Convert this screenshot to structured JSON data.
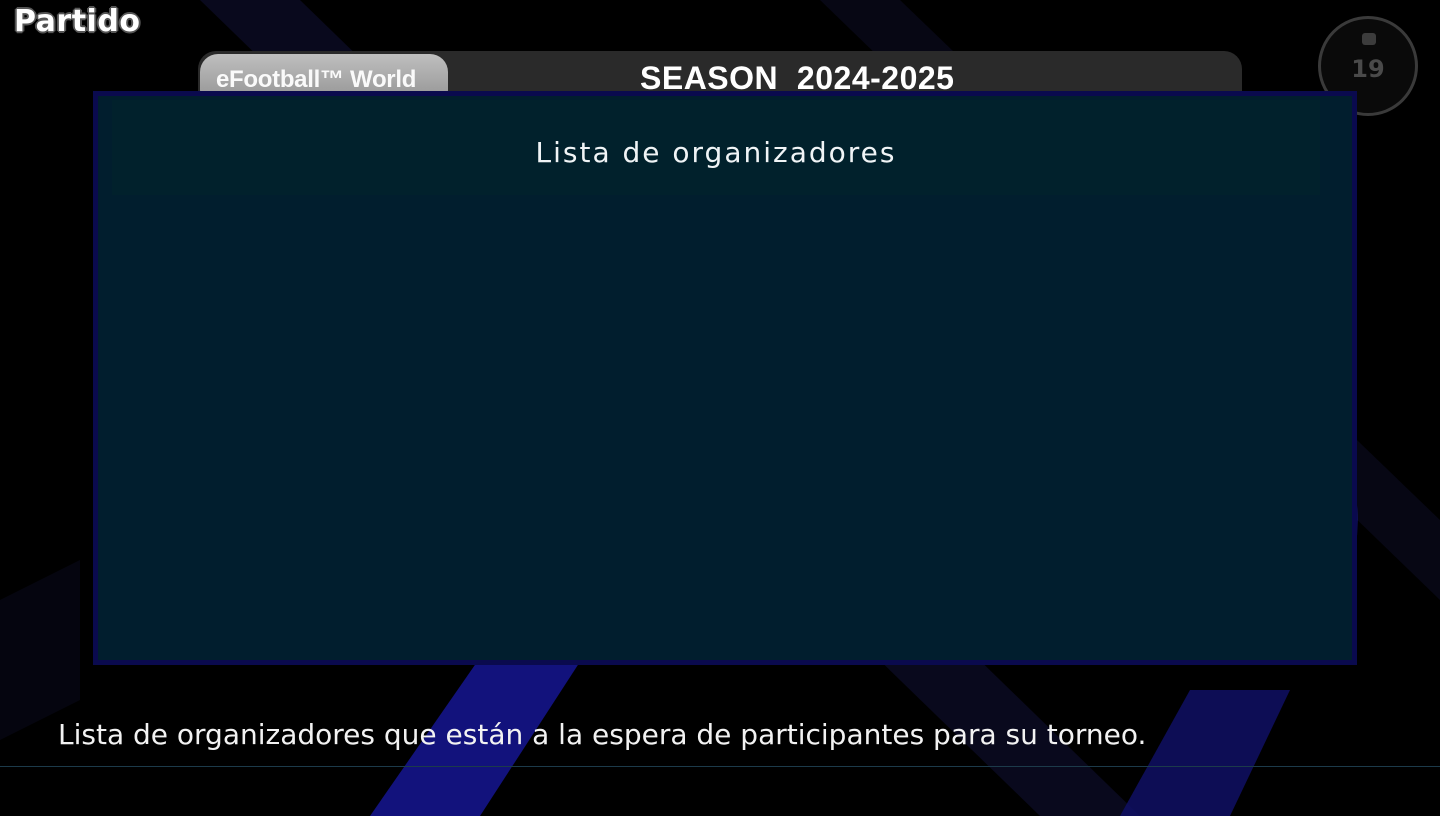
{
  "header": {
    "screen_title": "Partido",
    "world_tab_label": "eFootball™ World",
    "season_label": "SEASON  2024-2025",
    "badge_label": "19"
  },
  "panel": {
    "title": "Lista de organizadores",
    "items": []
  },
  "footer": {
    "description": "Lista de organizadores que están a la espera de participantes para su torneo."
  },
  "colors": {
    "background": "#000000",
    "panel_fill": "#011e2e",
    "panel_border": "#0a0a4e",
    "accent_stripe": "#1a1a8a"
  }
}
